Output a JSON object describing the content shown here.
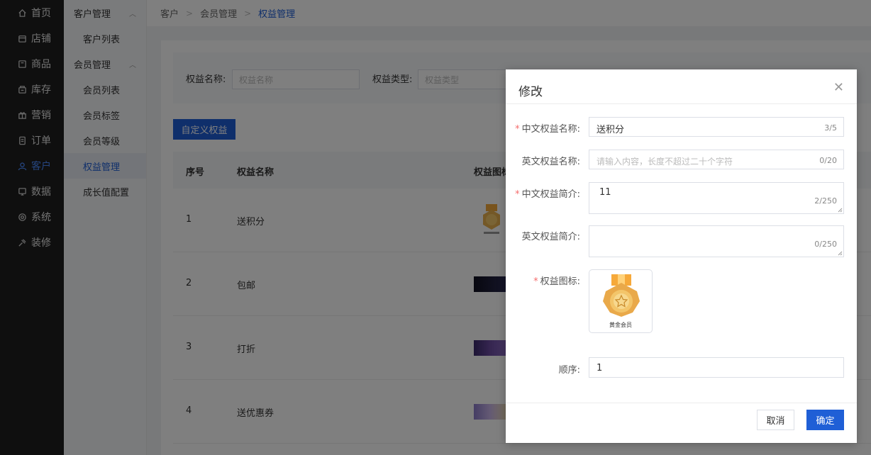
{
  "nav": [
    {
      "label": "首页",
      "icon": "home-icon"
    },
    {
      "label": "店铺",
      "icon": "shop-icon"
    },
    {
      "label": "商品",
      "icon": "product-icon"
    },
    {
      "label": "库存",
      "icon": "inventory-icon"
    },
    {
      "label": "营销",
      "icon": "gift-icon"
    },
    {
      "label": "订单",
      "icon": "order-icon"
    },
    {
      "label": "客户",
      "icon": "customer-icon"
    },
    {
      "label": "数据",
      "icon": "data-icon"
    },
    {
      "label": "系统",
      "icon": "settings-icon"
    },
    {
      "label": "装修",
      "icon": "decorate-icon"
    }
  ],
  "subnav": {
    "group1": "客户管理",
    "item1": "客户列表",
    "group2": "会员管理",
    "items": [
      "会员列表",
      "会员标签",
      "会员等级",
      "权益管理",
      "成长值配置"
    ]
  },
  "breadcrumb": [
    "客户",
    "会员管理",
    "权益管理"
  ],
  "filter": {
    "name_label": "权益名称:",
    "name_placeholder": "权益名称",
    "type_label": "权益类型:",
    "type_placeholder": "权益类型"
  },
  "custom_button": "自定义权益",
  "table": {
    "headers": [
      "序号",
      "权益名称",
      "权益图标"
    ],
    "rows": [
      {
        "no": "1",
        "name": "送积分"
      },
      {
        "no": "2",
        "name": "包邮"
      },
      {
        "no": "3",
        "name": "打折"
      },
      {
        "no": "4",
        "name": "送优惠券"
      }
    ]
  },
  "dialog": {
    "title": "修改",
    "fields": {
      "cn_name_label": "中文权益名称:",
      "cn_name_value": "送积分",
      "cn_name_count": "3/5",
      "en_name_label": "英文权益名称:",
      "en_name_placeholder": "请输入内容，长度不超过二十个字符",
      "en_name_count": "0/20",
      "cn_desc_label": "中文权益简介:",
      "cn_desc_value": "11",
      "cn_desc_count": "2/250",
      "en_desc_label": "英文权益简介:",
      "en_desc_count": "0/250",
      "icon_label": "权益图标:",
      "icon_caption": "黄金会员",
      "order_label": "顺序:",
      "order_value": "1"
    },
    "cancel": "取消",
    "confirm": "确定"
  },
  "colors": {
    "primary": "#1f5fd6",
    "required": "#f56c6c"
  }
}
